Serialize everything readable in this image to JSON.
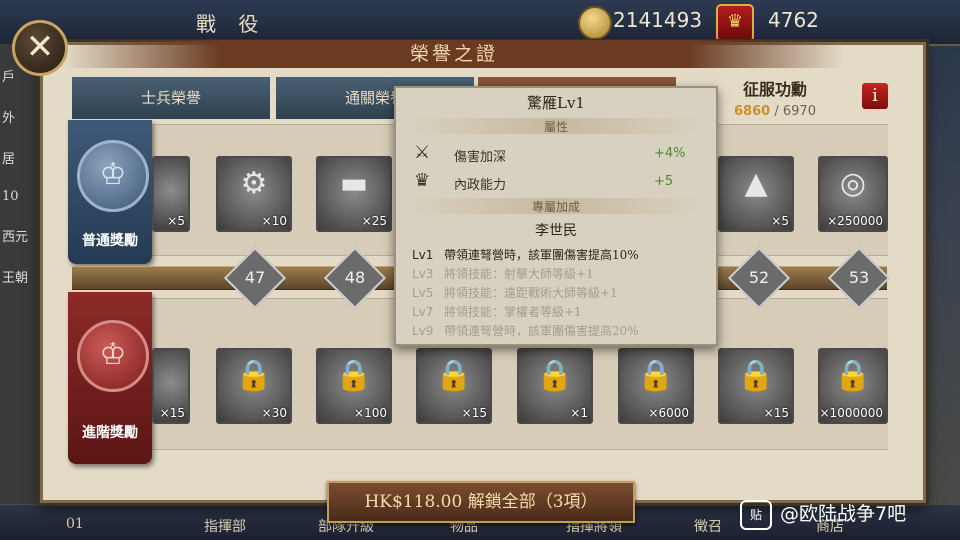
{
  "topbar": {
    "title": "戰 役",
    "gold": "2141493",
    "honor": "4762"
  },
  "left_strip": [
    "戶",
    "外",
    "居",
    "10",
    "西元",
    "王朝"
  ],
  "bottom_bar": [
    "01",
    "指揮部",
    "部隊升級",
    "物品",
    "指揮將領",
    "徵召",
    "商店"
  ],
  "panel": {
    "title": "榮譽之證",
    "tabs": [
      {
        "label": "士兵榮譽",
        "active": false
      },
      {
        "label": "通關榮譽",
        "active": false
      },
      {
        "label": "",
        "active": true
      }
    ],
    "conquest": {
      "label": "征服功勳",
      "current": "6860",
      "separator": "/",
      "total": "6970"
    },
    "info_label": "i"
  },
  "normal_rewards": {
    "label": "普通獎勵",
    "items": [
      {
        "icon": "gem-icon",
        "glyph": "◆",
        "count": "×5"
      },
      {
        "icon": "vehicle-puzzle-icon",
        "glyph": "⚙",
        "count": "×10"
      },
      {
        "icon": "gold-bar-icon",
        "glyph": "▬",
        "count": "×25"
      },
      {
        "icon": "crystal-icon",
        "glyph": "▲",
        "count": "×5"
      },
      {
        "icon": "coins-icon",
        "glyph": "◎",
        "count": "×250000"
      }
    ]
  },
  "milestones": [
    "47",
    "48",
    "52",
    "53"
  ],
  "advanced_rewards": {
    "label": "進階獎勵",
    "items": [
      {
        "icon": "locked-gem-icon",
        "count": "×15"
      },
      {
        "icon": "locked-puzzle-icon",
        "count": "×30"
      },
      {
        "icon": "locked-gold-bar-icon",
        "count": "×100"
      },
      {
        "icon": "locked-crystal-icon",
        "count": "×15"
      },
      {
        "icon": "locked-weapon-icon",
        "count": "×1"
      },
      {
        "icon": "locked-medal-icon",
        "count": "×6000"
      },
      {
        "icon": "locked-crystal-icon",
        "count": "×15"
      },
      {
        "icon": "locked-coins-icon",
        "count": "×1000000"
      }
    ]
  },
  "tooltip": {
    "title": "驚雁Lv1",
    "attr_header": "屬性",
    "attributes": [
      {
        "icon": "crossbow-icon",
        "label": "傷害加深",
        "value": "+4%"
      },
      {
        "icon": "crown-icon",
        "label": "內政能力",
        "value": "+5"
      }
    ],
    "exclusive_header": "專屬加成",
    "hero": "李世民",
    "levels": [
      {
        "lv": "Lv1",
        "text": "帶領連弩營時，該軍團傷害提高10%",
        "active": true
      },
      {
        "lv": "Lv3",
        "text": "將領技能：射擊大師等級+1",
        "active": false
      },
      {
        "lv": "Lv5",
        "text": "將領技能：遠距戰術大師等級+1",
        "active": false
      },
      {
        "lv": "Lv7",
        "text": "將領技能：掌權者等級+1",
        "active": false
      },
      {
        "lv": "Lv9",
        "text": "帶領連弩營時，該軍團傷害提高20%",
        "active": false
      }
    ]
  },
  "unlock_button": "HK$118.00 解鎖全部（3項）",
  "watermark": {
    "icon": "贴",
    "text": "@欧陆战争7吧"
  }
}
